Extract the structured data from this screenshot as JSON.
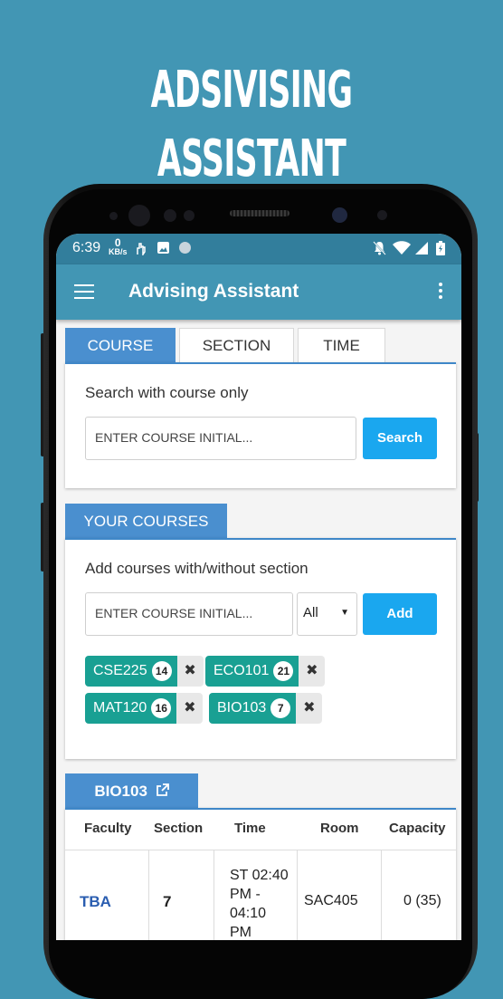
{
  "promo": {
    "title": "ADSIVISING ASSISTANT"
  },
  "status_bar": {
    "time": "6:39",
    "speed_value": "0",
    "speed_unit": "KB/s"
  },
  "app_bar": {
    "title": "Advising Assistant"
  },
  "search_tabs": [
    {
      "label": "COURSE",
      "active": true
    },
    {
      "label": "SECTION",
      "active": false
    },
    {
      "label": "TIME",
      "active": false
    }
  ],
  "search": {
    "caption": "Search with course only",
    "placeholder": "ENTER COURSE INITIAL...",
    "button_label": "Search"
  },
  "your_courses": {
    "tab_label": "YOUR COURSES",
    "caption": "Add courses with/without section",
    "placeholder": "ENTER COURSE INITIAL...",
    "section_select_value": "All",
    "add_label": "Add",
    "chips": [
      {
        "course": "CSE225",
        "section": "14"
      },
      {
        "course": "ECO101",
        "section": "21"
      },
      {
        "course": "MAT120",
        "section": "16"
      },
      {
        "course": "BIO103",
        "section": "7"
      }
    ]
  },
  "course_detail": {
    "tab_label": "BIO103",
    "headers": [
      "Faculty",
      "Section",
      "Time",
      "Room",
      "Capacity"
    ],
    "row": {
      "faculty": "TBA",
      "section": "7",
      "time_l1": "ST 02:40",
      "time_l2": "PM -",
      "time_l3": "04:10",
      "time_l4": "PM",
      "room": "SAC405",
      "capacity": "0 (35)"
    }
  },
  "colors": {
    "background": "#4296b4",
    "app_bar": "#4296b4",
    "status_bar": "#327e9c",
    "active_tab": "#4a8fcf",
    "primary_button": "#1aa7ef",
    "chip": "#19a093",
    "link": "#2a5db0"
  }
}
